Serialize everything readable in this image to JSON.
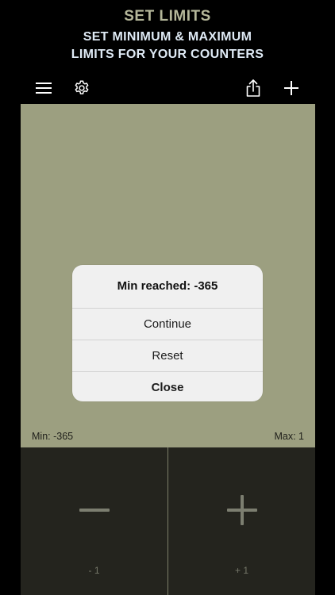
{
  "promo": {
    "title": "SET LIMITS",
    "subtitle_line1": "SET MINIMUM & MAXIMUM",
    "subtitle_line2": "LIMITS FOR YOUR COUNTERS"
  },
  "toolbar": {
    "icons": [
      "menu-icon",
      "gear-icon",
      "share-icon",
      "plus-icon"
    ]
  },
  "counter": {
    "background_color": "#9c9f80",
    "min_label": "Min: -365",
    "max_label": "Max: 1"
  },
  "dialog": {
    "title": "Min reached: -365",
    "actions": [
      "Continue",
      "Reset",
      "Close"
    ]
  },
  "controls": {
    "decrement_label": "- 1",
    "increment_label": "+ 1"
  }
}
